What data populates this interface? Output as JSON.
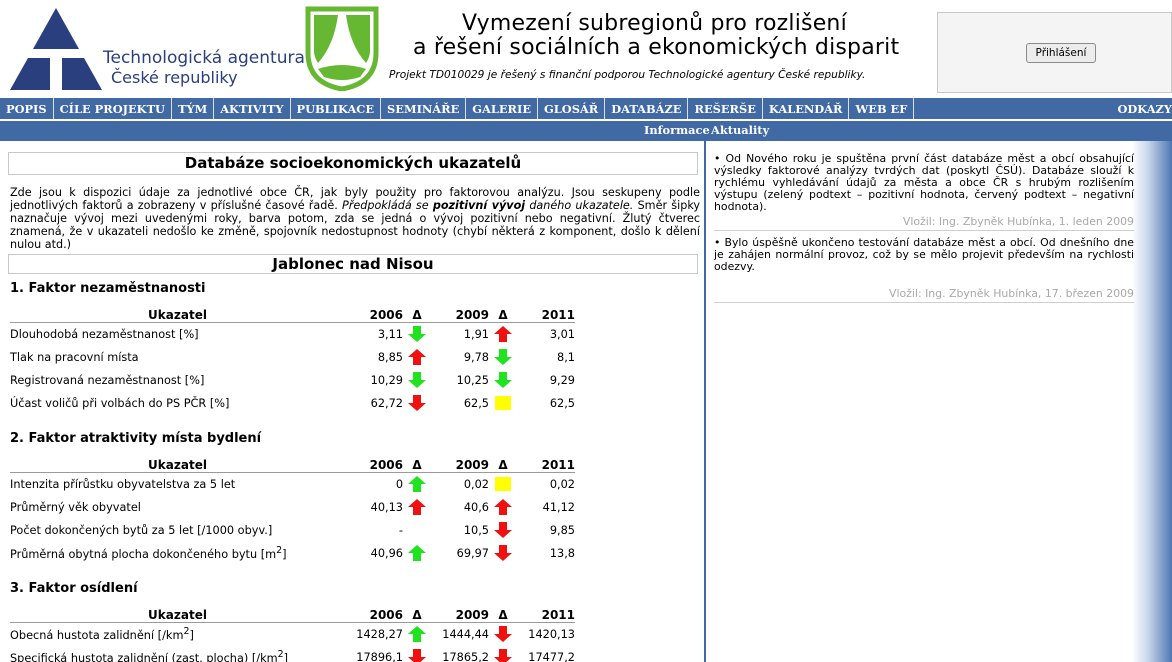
{
  "header": {
    "agency_name": "Technologická agentura",
    "agency_sub": "České republiky",
    "title_line1": "Vymezení subregionů pro rozlišení",
    "title_line2": "a řešení sociálních a ekonomických disparit",
    "subtitle": "Projekt TD010029 je řešený s finanční podporou Technologické agentury České republiky.",
    "login_label": "Přihlášení"
  },
  "colors": {
    "menu_bg": "#4169a3",
    "arrow_up": "#1ee31e",
    "arrow_down": "#f01010",
    "square": "#ffff00"
  },
  "menu": [
    "POPIS",
    "CÍLE PROJEKTU",
    "TÝM",
    "AKTIVITY",
    "PUBLIKACE",
    "SEMINÁŘE",
    "GALERIE",
    "GLOSÁŘ",
    "DATABÁZE",
    "REŠERŠE",
    "KALENDÁŘ",
    "WEB EF"
  ],
  "menu_right": "ODKAZY",
  "subtabs": {
    "info": "Informace",
    "news": "Aktuality"
  },
  "main": {
    "db_title": "Databáze socioekonomických ukazatelů",
    "intro_a": "Zde jsou k dispozici údaje za jednotlivé obce ČR, jak byly použity pro faktorovou analýzu. Jsou seskupeny podle jednotlivých faktorů a zobrazeny v příslušné časové řadě. ",
    "intro_b": "Předpokládá se ",
    "intro_c": "pozitivní vývoj",
    "intro_d": " daného ukazatele.",
    "intro_e": " Směr šipky naznačuje vývoj mezi uvedenými roky, barva potom, zda se jedná o vývoj pozitivní nebo negativní. Žlutý čtverec znamená, že v ukazateli nedošlo ke změně, spojovník nedostupnost hodnoty (chybí některá z komponent, došlo k dělení nulou atd.)",
    "city": "Jablonec nad Nisou",
    "table_header": {
      "label": "Ukazatel",
      "y1": "2006",
      "delta": "Δ",
      "y2": "2009",
      "y3": "2011"
    },
    "factors": [
      {
        "name": "1. Faktor nezaměstnanosti",
        "rows": [
          {
            "label": "Dlouhodobá nezaměstnanost [%]",
            "v1": "3,11",
            "a1": "down-green",
            "v2": "1,91",
            "a2": "up-red",
            "v3": "3,01"
          },
          {
            "label": "Tlak na pracovní místa",
            "v1": "8,85",
            "a1": "up-red",
            "v2": "9,78",
            "a2": "down-green",
            "v3": "8,1"
          },
          {
            "label": "Registrovaná nezaměstnanost [%]",
            "v1": "10,29",
            "a1": "down-green",
            "v2": "10,25",
            "a2": "down-green",
            "v3": "9,29"
          },
          {
            "label": "Účast voličů při volbách do PS PČR [%]",
            "v1": "62,72",
            "a1": "down-red",
            "v2": "62,5",
            "a2": "square",
            "v3": "62,5"
          }
        ]
      },
      {
        "name": "2. Faktor atraktivity místa bydlení",
        "rows": [
          {
            "label": "Intenzita přírůstku obyvatelstva za 5 let",
            "v1": "0",
            "a1": "up-green",
            "v2": "0,02",
            "a2": "square",
            "v3": "0,02"
          },
          {
            "label": "Průměrný věk obyvatel",
            "v1": "40,13",
            "a1": "up-red",
            "v2": "40,6",
            "a2": "up-red",
            "v3": "41,12"
          },
          {
            "label": "Počet dokončených bytů za 5 let [/1000 obyv.]",
            "v1": "-",
            "a1": "none",
            "v2": "10,5",
            "a2": "down-red",
            "v3": "9,85"
          },
          {
            "label": "Průměrná obytná plocha dokončeného bytu [m",
            "label_sup": "2",
            "label_end": "]",
            "v1": "40,96",
            "a1": "up-green",
            "v2": "69,97",
            "a2": "down-red",
            "v3": "13,8"
          }
        ]
      },
      {
        "name": "3. Faktor osídlení",
        "rows": [
          {
            "label": "Obecná hustota zalidnění [/km",
            "label_sup": "2",
            "label_end": "]",
            "v1": "1428,27",
            "a1": "up-green",
            "v2": "1444,44",
            "a2": "down-red",
            "v3": "1420,13"
          },
          {
            "label": "Specifická hustota zalidnění (zast. plocha) [/km",
            "label_sup": "2",
            "label_end": "]",
            "v1": "17896,1",
            "a1": "down-red",
            "v2": "17865,2",
            "a2": "down-red",
            "v3": "17477,2"
          }
        ]
      }
    ]
  },
  "news": [
    {
      "text": "• Od Nového roku je spuštěna první část databáze měst a obcí obsahující výsledky faktorové analýzy tvrdých dat (poskytl ČSÚ). Databáze slouží k rychlému vyhledávání údajů za města a obce ČR s hrubým rozlišením výstupu (zelený podtext – pozitivní hodnota, červený podtext – negativní hodnota).",
      "meta": "Vložil: Ing. Zbyněk Hubínka, 1. leden 2009"
    },
    {
      "text": "• Bylo úspěšně ukončeno testování databáze měst a obcí. Od dnešního dne je zahájen normální provoz, což by se mělo projevit především na rychlosti odezvy.",
      "meta": "Vložil: Ing. Zbyněk Hubínka, 17. březen 2009"
    }
  ]
}
